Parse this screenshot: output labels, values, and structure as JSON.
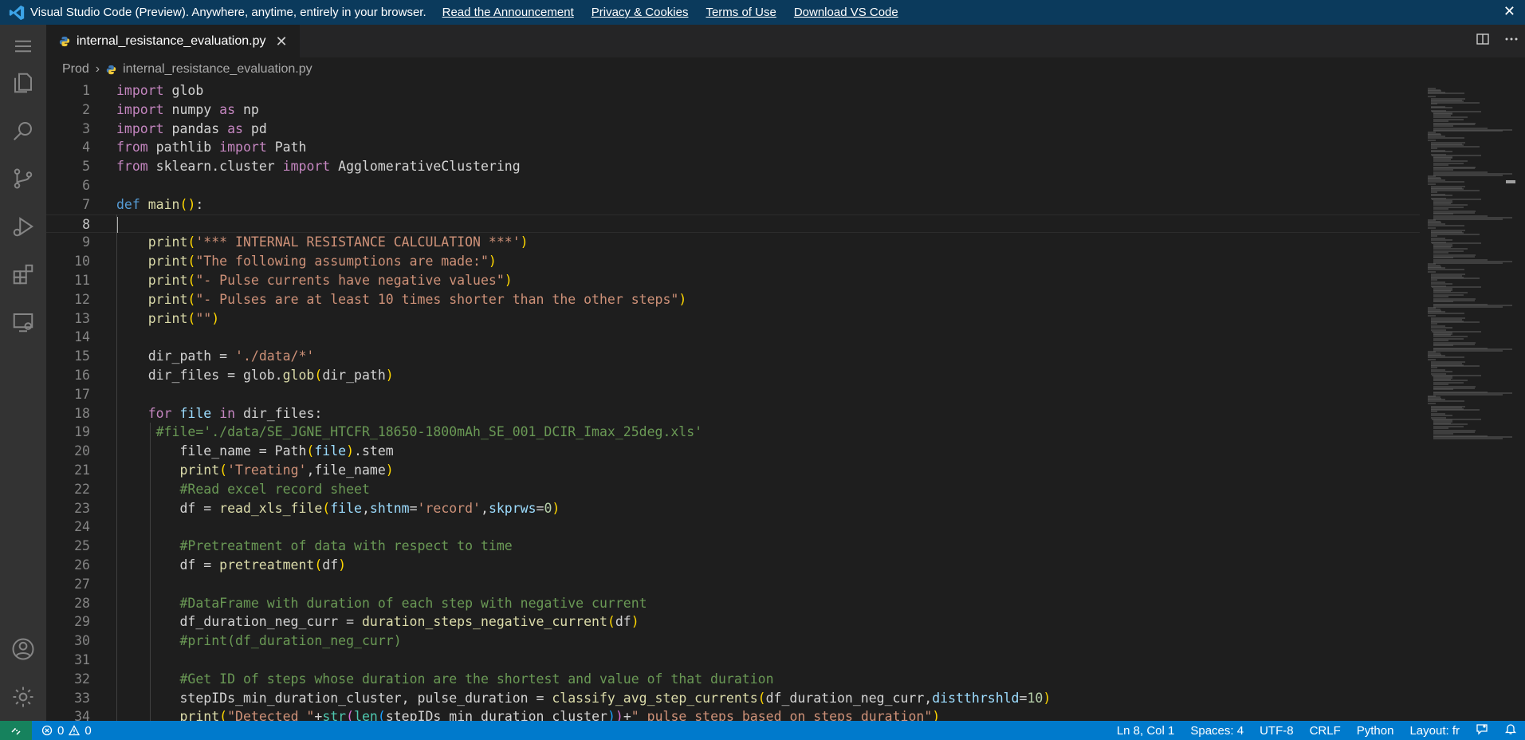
{
  "banner": {
    "message": "Visual Studio Code (Preview). Anywhere, anytime, entirely in your browser.",
    "links": [
      "Read the Announcement",
      "Privacy & Cookies",
      "Terms of Use",
      "Download VS Code"
    ],
    "close_glyph": "✕"
  },
  "activity_bar": {
    "items": [
      "explorer-icon",
      "search-icon",
      "source-control-icon",
      "run-debug-icon",
      "extensions-icon",
      "remote-explorer-icon",
      "accounts-icon",
      "settings-gear-icon"
    ]
  },
  "tab": {
    "label": "internal_resistance_evaluation.py",
    "close_glyph": "✕"
  },
  "breadcrumb": {
    "folder": "Prod",
    "file": "internal_resistance_evaluation.py"
  },
  "editor": {
    "current_line": 8,
    "lines": [
      {
        "n": "1",
        "code": "import glob"
      },
      {
        "n": "2",
        "code": "import numpy as np"
      },
      {
        "n": "3",
        "code": "import pandas as pd"
      },
      {
        "n": "4",
        "code": "from pathlib import Path"
      },
      {
        "n": "5",
        "code": "from sklearn.cluster import AgglomerativeClustering"
      },
      {
        "n": "6",
        "code": ""
      },
      {
        "n": "7",
        "code": "def main():"
      },
      {
        "n": "8",
        "code": ""
      },
      {
        "n": "9",
        "code": "    print('*** INTERNAL RESISTANCE CALCULATION ***')"
      },
      {
        "n": "10",
        "code": "    print(\"The following assumptions are made:\")"
      },
      {
        "n": "11",
        "code": "    print(\"- Pulse currents have negative values\")"
      },
      {
        "n": "12",
        "code": "    print(\"- Pulses are at least 10 times shorter than the other steps\")"
      },
      {
        "n": "13",
        "code": "    print(\"\")"
      },
      {
        "n": "14",
        "code": ""
      },
      {
        "n": "15",
        "code": "    dir_path = './data/*'"
      },
      {
        "n": "16",
        "code": "    dir_files = glob.glob(dir_path)"
      },
      {
        "n": "17",
        "code": ""
      },
      {
        "n": "18",
        "code": "    for file in dir_files:"
      },
      {
        "n": "19",
        "code": "     #file='./data/SE_JGNE_HTCFR_18650-1800mAh_SE_001_DCIR_Imax_25deg.xls'"
      },
      {
        "n": "20",
        "code": "        file_name = Path(file).stem"
      },
      {
        "n": "21",
        "code": "        print('Treating',file_name)"
      },
      {
        "n": "22",
        "code": "        #Read excel record sheet"
      },
      {
        "n": "23",
        "code": "        df = read_xls_file(file,shtnm='record',skprws=0)"
      },
      {
        "n": "24",
        "code": ""
      },
      {
        "n": "25",
        "code": "        #Pretreatment of data with respect to time"
      },
      {
        "n": "26",
        "code": "        df = pretreatment(df)"
      },
      {
        "n": "27",
        "code": ""
      },
      {
        "n": "28",
        "code": "        #DataFrame with duration of each step with negative current"
      },
      {
        "n": "29",
        "code": "        df_duration_neg_curr = duration_steps_negative_current(df)"
      },
      {
        "n": "30",
        "code": "        #print(df_duration_neg_curr)"
      },
      {
        "n": "31",
        "code": ""
      },
      {
        "n": "32",
        "code": "        #Get ID of steps whose duration are the shortest and value of that duration"
      },
      {
        "n": "33",
        "code": "        stepIDs_min_duration_cluster, pulse_duration = classify_avg_step_currents(df_duration_neg_curr,distthrshld=10)"
      },
      {
        "n": "34",
        "code": "        print(\"Detected \"+str(len(stepIDs_min_duration_cluster))+\" pulse steps based on steps duration\")"
      }
    ]
  },
  "status_bar": {
    "errors": "0",
    "warnings": "0",
    "position": "Ln 8, Col 1",
    "spaces": "Spaces: 4",
    "encoding": "UTF-8",
    "eol": "CRLF",
    "language": "Python",
    "layout": "Layout: fr"
  },
  "colors": {
    "banner": "#0b3a5c",
    "activity_bar": "#333333",
    "editor_bg": "#1e1e1e",
    "status_bar": "#007acc",
    "remote_indicator": "#16825d"
  }
}
